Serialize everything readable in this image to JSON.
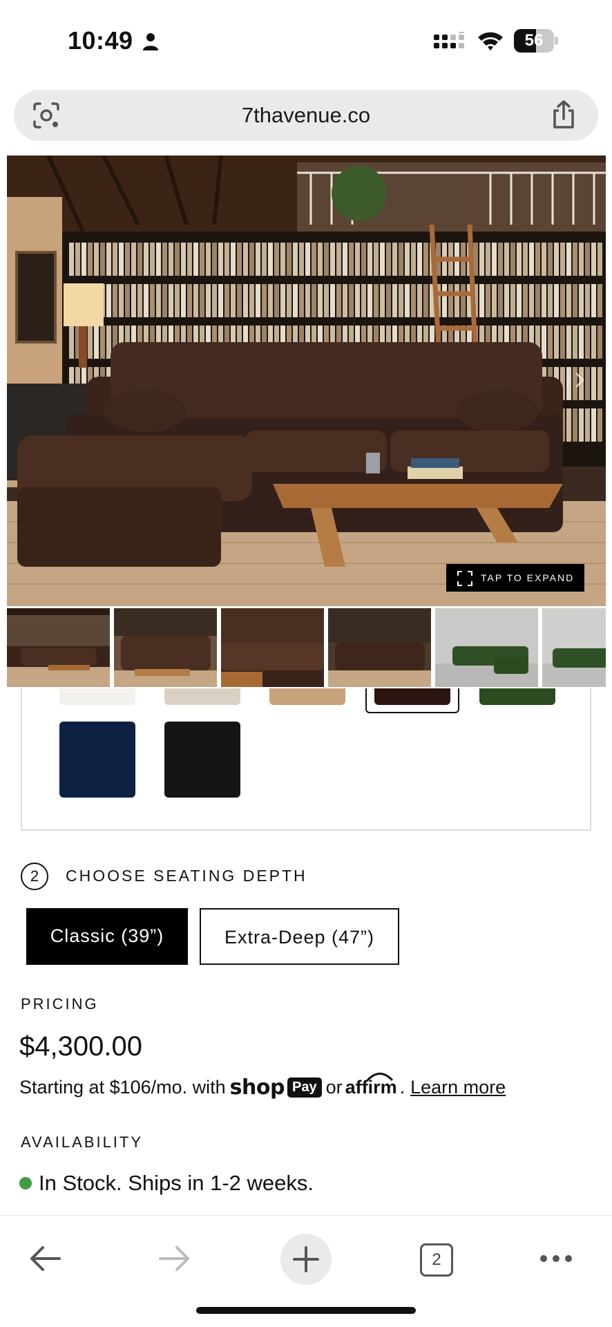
{
  "status_bar": {
    "time": "10:49",
    "battery_level": "56",
    "icons": [
      "person-icon",
      "signal-icon",
      "wifi-icon",
      "battery-icon"
    ]
  },
  "browser": {
    "url": "7thavenue.co",
    "left_icon": "lens-icon",
    "right_icon": "share-icon"
  },
  "gallery": {
    "expand_label": "TAP TO EXPAND",
    "thumbnail_count": 6,
    "selected_thumbnail": 1
  },
  "colors": {
    "swatches_row1": [
      "#f3f1ec",
      "#d9d2c4",
      "#c7a27a",
      "#2b1510",
      "#2c4a1f"
    ],
    "swatches_row2": [
      "#0f2142",
      "#151515"
    ],
    "selected_index": 3
  },
  "seating": {
    "step": "2",
    "title": "CHOOSE SEATING DEPTH",
    "options": [
      {
        "label": "Classic (39”)",
        "selected": true
      },
      {
        "label": "Extra-Deep (47”)",
        "selected": false
      }
    ]
  },
  "pricing": {
    "label": "PRICING",
    "price": "$4,300.00",
    "financing_prefix": "Starting at $106/mo. with",
    "shop_word": "shop",
    "pay_word": "Pay",
    "or_word": "or",
    "affirm_word": "affirm",
    "period": ".",
    "learn_more": "Learn more"
  },
  "availability": {
    "label": "AVAILABILITY",
    "status": "In Stock. Ships in 1-2 weeks.",
    "status_color": "#3f9b3f"
  },
  "toolbar": {
    "tab_count": "2"
  }
}
